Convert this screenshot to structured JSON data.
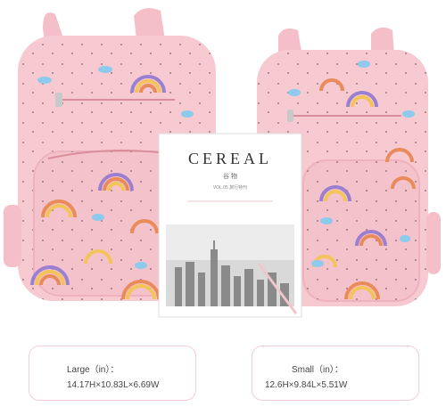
{
  "photo": {
    "magazine": {
      "title": "CEREAL",
      "subtitle": "谷 物",
      "issue_line": "VOL.05 旅行特刊"
    }
  },
  "sizes": [
    {
      "title": "Large（in）：",
      "dims": "14.17H×10.83L×6.69W"
    },
    {
      "title": "Small（in）：",
      "dims": "12.6H×9.84L×5.51W"
    }
  ],
  "colors": {
    "bag_pink": "#f7c9d1",
    "bag_pink_dark": "#eeb2be",
    "card_border": "#f2cfd5",
    "rainbow_orange": "#e98b5a",
    "rainbow_purple": "#9b7fd0",
    "rainbow_yellow": "#f2c45a",
    "cloud_blue": "#8ec9ee"
  }
}
